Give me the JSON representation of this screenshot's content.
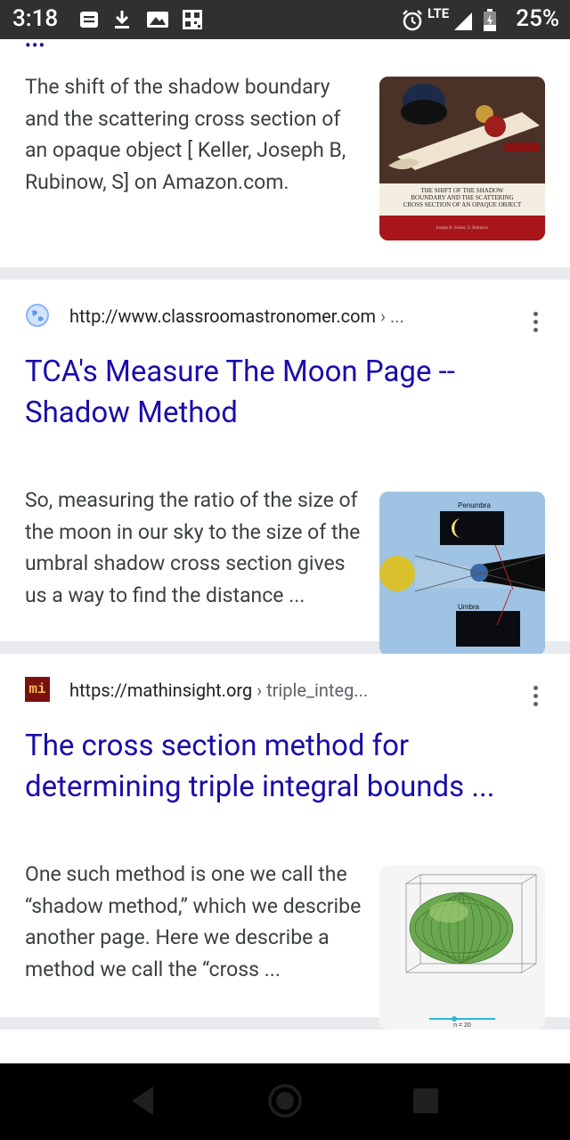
{
  "status_bar": {
    "time": "3:18",
    "network": "LTE",
    "battery": "25%"
  },
  "results": [
    {
      "snippet": "The shift of the shadow boundary and the scattering cross section of an opaque object [ Keller, Joseph B, Rubinow, S] on Amazon.com.",
      "thumb_title": "THE SHIFT OF THE SHADOW BOUNDARY AND THE SCATTERING CROSS SECTION OF AN OPAQUE OBJECT",
      "thumb_author": "Joseph B. Keller, S. Rubinow"
    },
    {
      "url": "http://www.classroomastronomer.com",
      "url_path": " › ...",
      "title": "TCA's Measure The Moon Page -- Shadow Method",
      "snippet": "So, measuring the ratio of the size of the moon in our sky to the size of the umbral shadow cross section gives us a way to find the distance ...",
      "thumb_labels": {
        "top": "Penumbra",
        "bottom": "Umbra"
      }
    },
    {
      "url": "https://mathinsight.org",
      "url_path": " › triple_integ...",
      "favicon_text": "mi",
      "title": "The cross section method for determining triple integral bounds ...",
      "snippet": "One such method is one we call the “shadow method,” which we describe another page. Here we describe a method we call the “cross  ...",
      "thumb_caption": "n = 20"
    }
  ],
  "colors": {
    "link": "#1a0dab",
    "text": "#3c4043",
    "status_bar": "#303030",
    "nav_bar": "#000000"
  },
  "icons": [
    "message-icon",
    "download-icon",
    "image-icon",
    "qr-icon",
    "alarm-icon",
    "signal-icon",
    "battery-icon",
    "back-icon",
    "home-icon",
    "recents-icon",
    "more-options-icon",
    "globe-icon"
  ]
}
